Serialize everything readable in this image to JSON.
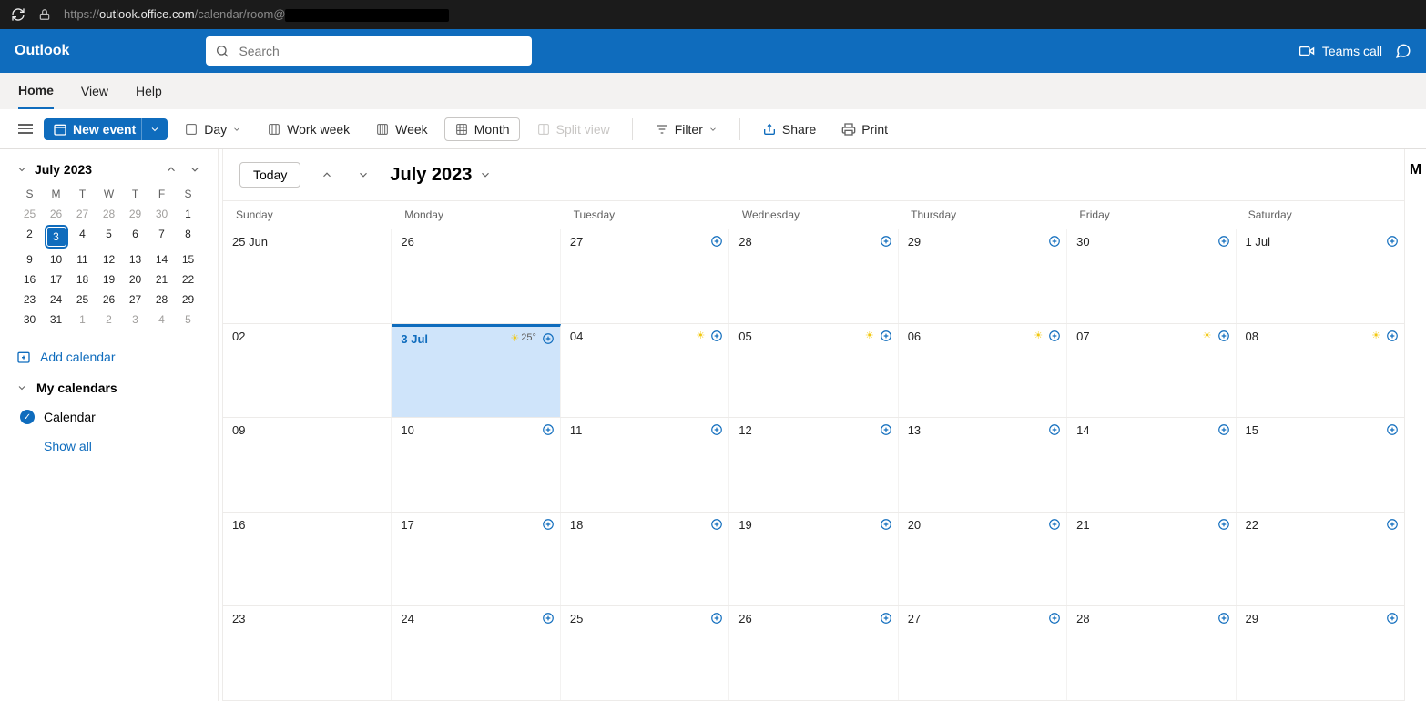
{
  "browser": {
    "url_prefix": "https://",
    "url_host": "outlook.office.com",
    "url_path": "/calendar/room@"
  },
  "header": {
    "app_title": "Outlook",
    "search_placeholder": "Search",
    "teams_call": "Teams call"
  },
  "tabs": {
    "home": "Home",
    "view": "View",
    "help": "Help"
  },
  "toolbar": {
    "new_event": "New event",
    "day": "Day",
    "work_week": "Work week",
    "week": "Week",
    "month": "Month",
    "split_view": "Split view",
    "filter": "Filter",
    "share": "Share",
    "print": "Print"
  },
  "mini": {
    "title": "July 2023",
    "dows": [
      "S",
      "M",
      "T",
      "W",
      "T",
      "F",
      "S"
    ],
    "weeks": [
      [
        {
          "n": "25",
          "dim": true
        },
        {
          "n": "26",
          "dim": true
        },
        {
          "n": "27",
          "dim": true
        },
        {
          "n": "28",
          "dim": true
        },
        {
          "n": "29",
          "dim": true
        },
        {
          "n": "30",
          "dim": true
        },
        {
          "n": "1"
        }
      ],
      [
        {
          "n": "2"
        },
        {
          "n": "3",
          "today": true
        },
        {
          "n": "4"
        },
        {
          "n": "5"
        },
        {
          "n": "6"
        },
        {
          "n": "7"
        },
        {
          "n": "8"
        }
      ],
      [
        {
          "n": "9"
        },
        {
          "n": "10"
        },
        {
          "n": "11"
        },
        {
          "n": "12"
        },
        {
          "n": "13"
        },
        {
          "n": "14"
        },
        {
          "n": "15"
        }
      ],
      [
        {
          "n": "16"
        },
        {
          "n": "17"
        },
        {
          "n": "18"
        },
        {
          "n": "19"
        },
        {
          "n": "20"
        },
        {
          "n": "21"
        },
        {
          "n": "22"
        }
      ],
      [
        {
          "n": "23"
        },
        {
          "n": "24"
        },
        {
          "n": "25"
        },
        {
          "n": "26"
        },
        {
          "n": "27"
        },
        {
          "n": "28"
        },
        {
          "n": "29"
        }
      ],
      [
        {
          "n": "30"
        },
        {
          "n": "31"
        },
        {
          "n": "1",
          "dim": true
        },
        {
          "n": "2",
          "dim": true
        },
        {
          "n": "3",
          "dim": true
        },
        {
          "n": "4",
          "dim": true
        },
        {
          "n": "5",
          "dim": true
        }
      ]
    ]
  },
  "sidebar": {
    "add_calendar": "Add calendar",
    "my_calendars": "My calendars",
    "calendar_item": "Calendar",
    "show_all": "Show all"
  },
  "main": {
    "today_btn": "Today",
    "month_title": "July 2023",
    "dows": [
      "Sunday",
      "Monday",
      "Tuesday",
      "Wednesday",
      "Thursday",
      "Friday",
      "Saturday"
    ],
    "weeks": [
      [
        {
          "label": "25 Jun"
        },
        {
          "label": "26"
        },
        {
          "label": "27",
          "add": true
        },
        {
          "label": "28",
          "add": true
        },
        {
          "label": "29",
          "add": true
        },
        {
          "label": "30",
          "add": true
        },
        {
          "label": "1 Jul",
          "add": true
        }
      ],
      [
        {
          "label": "02"
        },
        {
          "label": "3 Jul",
          "today": true,
          "add": true,
          "weather": "25°"
        },
        {
          "label": "04",
          "add": true,
          "sun": true
        },
        {
          "label": "05",
          "add": true,
          "sun": true
        },
        {
          "label": "06",
          "add": true,
          "sun": true
        },
        {
          "label": "07",
          "add": true,
          "sun": true
        },
        {
          "label": "08",
          "add": true,
          "sun": true
        }
      ],
      [
        {
          "label": "09"
        },
        {
          "label": "10",
          "add": true
        },
        {
          "label": "11",
          "add": true
        },
        {
          "label": "12",
          "add": true
        },
        {
          "label": "13",
          "add": true
        },
        {
          "label": "14",
          "add": true
        },
        {
          "label": "15",
          "add": true
        }
      ],
      [
        {
          "label": "16"
        },
        {
          "label": "17",
          "add": true
        },
        {
          "label": "18",
          "add": true
        },
        {
          "label": "19",
          "add": true
        },
        {
          "label": "20",
          "add": true
        },
        {
          "label": "21",
          "add": true
        },
        {
          "label": "22",
          "add": true
        }
      ],
      [
        {
          "label": "23"
        },
        {
          "label": "24",
          "add": true
        },
        {
          "label": "25",
          "add": true
        },
        {
          "label": "26",
          "add": true
        },
        {
          "label": "27",
          "add": true
        },
        {
          "label": "28",
          "add": true
        },
        {
          "label": "29",
          "add": true
        }
      ]
    ]
  },
  "side_panel_letter": "M"
}
